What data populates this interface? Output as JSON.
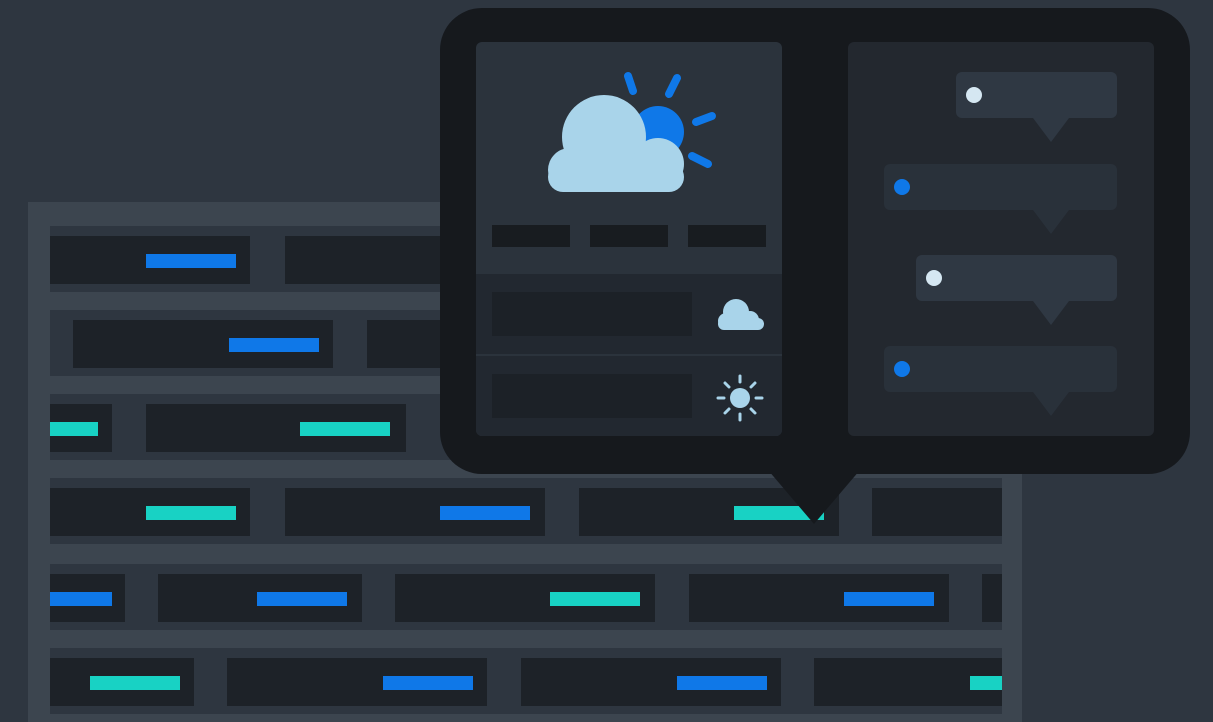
{
  "colors": {
    "background": "#2e3640",
    "accent_blue": "#0f78e8",
    "accent_teal": "#18d2c4",
    "cloud": "#a9d4ea",
    "popover": "#16191d"
  },
  "weather": {
    "hero_icon": "partly-cloudy-icon",
    "day_tabs": 3,
    "forecast": [
      {
        "icon": "cloud-icon"
      },
      {
        "icon": "sun-icon"
      }
    ]
  },
  "notifications": [
    {
      "dot": "light"
    },
    {
      "dot": "blue"
    },
    {
      "dot": "light"
    },
    {
      "dot": "blue"
    }
  ]
}
